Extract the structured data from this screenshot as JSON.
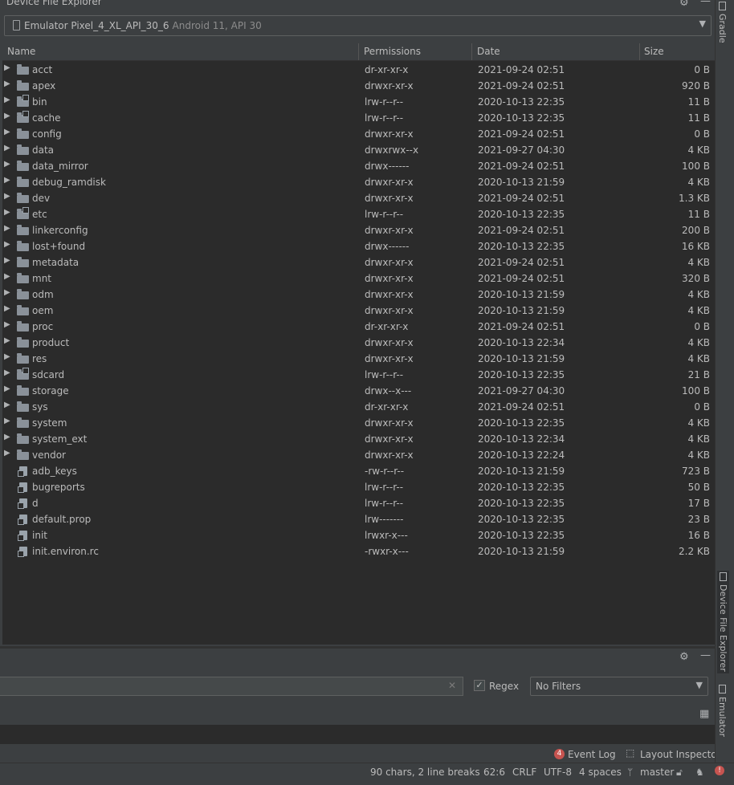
{
  "window": {
    "title": "Device File Explorer"
  },
  "device": {
    "name": "Emulator Pixel_4_XL_API_30_6",
    "detail": "Android 11, API 30"
  },
  "columns": {
    "name": "Name",
    "permissions": "Permissions",
    "date": "Date",
    "size": "Size"
  },
  "rows": [
    {
      "name": "acct",
      "type": "folder",
      "permissions": "dr-xr-xr-x",
      "date": "2021-09-24 02:51",
      "size": "0 B"
    },
    {
      "name": "apex",
      "type": "folder",
      "permissions": "drwxr-xr-x",
      "date": "2021-09-24 02:51",
      "size": "920 B"
    },
    {
      "name": "bin",
      "type": "folder-link",
      "permissions": "lrw-r--r--",
      "date": "2020-10-13 22:35",
      "size": "11 B"
    },
    {
      "name": "cache",
      "type": "folder-link",
      "permissions": "lrw-r--r--",
      "date": "2020-10-13 22:35",
      "size": "11 B"
    },
    {
      "name": "config",
      "type": "folder",
      "permissions": "drwxr-xr-x",
      "date": "2021-09-24 02:51",
      "size": "0 B"
    },
    {
      "name": "data",
      "type": "folder",
      "permissions": "drwxrwx--x",
      "date": "2021-09-27 04:30",
      "size": "4 KB"
    },
    {
      "name": "data_mirror",
      "type": "folder",
      "permissions": "drwx------",
      "date": "2021-09-24 02:51",
      "size": "100 B"
    },
    {
      "name": "debug_ramdisk",
      "type": "folder",
      "permissions": "drwxr-xr-x",
      "date": "2020-10-13 21:59",
      "size": "4 KB"
    },
    {
      "name": "dev",
      "type": "folder",
      "permissions": "drwxr-xr-x",
      "date": "2021-09-24 02:51",
      "size": "1.3 KB"
    },
    {
      "name": "etc",
      "type": "folder-link",
      "permissions": "lrw-r--r--",
      "date": "2020-10-13 22:35",
      "size": "11 B"
    },
    {
      "name": "linkerconfig",
      "type": "folder",
      "permissions": "drwxr-xr-x",
      "date": "2021-09-24 02:51",
      "size": "200 B"
    },
    {
      "name": "lost+found",
      "type": "folder",
      "permissions": "drwx------",
      "date": "2020-10-13 22:35",
      "size": "16 KB"
    },
    {
      "name": "metadata",
      "type": "folder",
      "permissions": "drwxr-xr-x",
      "date": "2021-09-24 02:51",
      "size": "4 KB"
    },
    {
      "name": "mnt",
      "type": "folder",
      "permissions": "drwxr-xr-x",
      "date": "2021-09-24 02:51",
      "size": "320 B"
    },
    {
      "name": "odm",
      "type": "folder",
      "permissions": "drwxr-xr-x",
      "date": "2020-10-13 21:59",
      "size": "4 KB"
    },
    {
      "name": "oem",
      "type": "folder",
      "permissions": "drwxr-xr-x",
      "date": "2020-10-13 21:59",
      "size": "4 KB"
    },
    {
      "name": "proc",
      "type": "folder",
      "permissions": "dr-xr-xr-x",
      "date": "2021-09-24 02:51",
      "size": "0 B"
    },
    {
      "name": "product",
      "type": "folder",
      "permissions": "drwxr-xr-x",
      "date": "2020-10-13 22:34",
      "size": "4 KB"
    },
    {
      "name": "res",
      "type": "folder",
      "permissions": "drwxr-xr-x",
      "date": "2020-10-13 21:59",
      "size": "4 KB"
    },
    {
      "name": "sdcard",
      "type": "folder-link",
      "permissions": "lrw-r--r--",
      "date": "2020-10-13 22:35",
      "size": "21 B"
    },
    {
      "name": "storage",
      "type": "folder",
      "permissions": "drwx--x---",
      "date": "2021-09-27 04:30",
      "size": "100 B"
    },
    {
      "name": "sys",
      "type": "folder",
      "permissions": "dr-xr-xr-x",
      "date": "2021-09-24 02:51",
      "size": "0 B"
    },
    {
      "name": "system",
      "type": "folder",
      "permissions": "drwxr-xr-x",
      "date": "2020-10-13 22:35",
      "size": "4 KB"
    },
    {
      "name": "system_ext",
      "type": "folder",
      "permissions": "drwxr-xr-x",
      "date": "2020-10-13 22:34",
      "size": "4 KB"
    },
    {
      "name": "vendor",
      "type": "folder",
      "permissions": "drwxr-xr-x",
      "date": "2020-10-13 22:24",
      "size": "4 KB"
    },
    {
      "name": "adb_keys",
      "type": "file-link",
      "permissions": "-rw-r--r--",
      "date": "2020-10-13 21:59",
      "size": "723 B"
    },
    {
      "name": "bugreports",
      "type": "file-link",
      "permissions": "lrw-r--r--",
      "date": "2020-10-13 22:35",
      "size": "50 B"
    },
    {
      "name": "d",
      "type": "file-link",
      "permissions": "lrw-r--r--",
      "date": "2020-10-13 22:35",
      "size": "17 B"
    },
    {
      "name": "default.prop",
      "type": "file-link",
      "permissions": "lrw-------",
      "date": "2020-10-13 22:35",
      "size": "23 B"
    },
    {
      "name": "init",
      "type": "file-link",
      "permissions": "lrwxr-x---",
      "date": "2020-10-13 22:35",
      "size": "16 B"
    },
    {
      "name": "init.environ.rc",
      "type": "file-link",
      "permissions": "-rwxr-x---",
      "date": "2020-10-13 21:59",
      "size": "2.2 KB"
    }
  ],
  "logcat": {
    "regex_label": "Regex",
    "regex_checked": true,
    "filter_value": "No Filters"
  },
  "events": {
    "badge_count": "4",
    "event_log": "Event Log",
    "layout_inspector": "Layout Inspector"
  },
  "status": {
    "selection": "90 chars, 2 line breaks",
    "position": "62:6",
    "line_sep": "CRLF",
    "encoding": "UTF-8",
    "indent": "4 spaces",
    "branch": "master"
  },
  "side_tabs": {
    "gradle": "Gradle",
    "device_file_explorer": "Device File Explorer",
    "emulator": "Emulator"
  },
  "icons": [
    "gear-icon",
    "minimize-icon",
    "phone-icon",
    "chevron-down-icon",
    "expand-arrow-icon",
    "folder-icon",
    "file-icon",
    "close-icon",
    "checkbox-icon",
    "layout-icon",
    "branch-icon",
    "lock-icon",
    "inspector-icon",
    "error-icon"
  ]
}
